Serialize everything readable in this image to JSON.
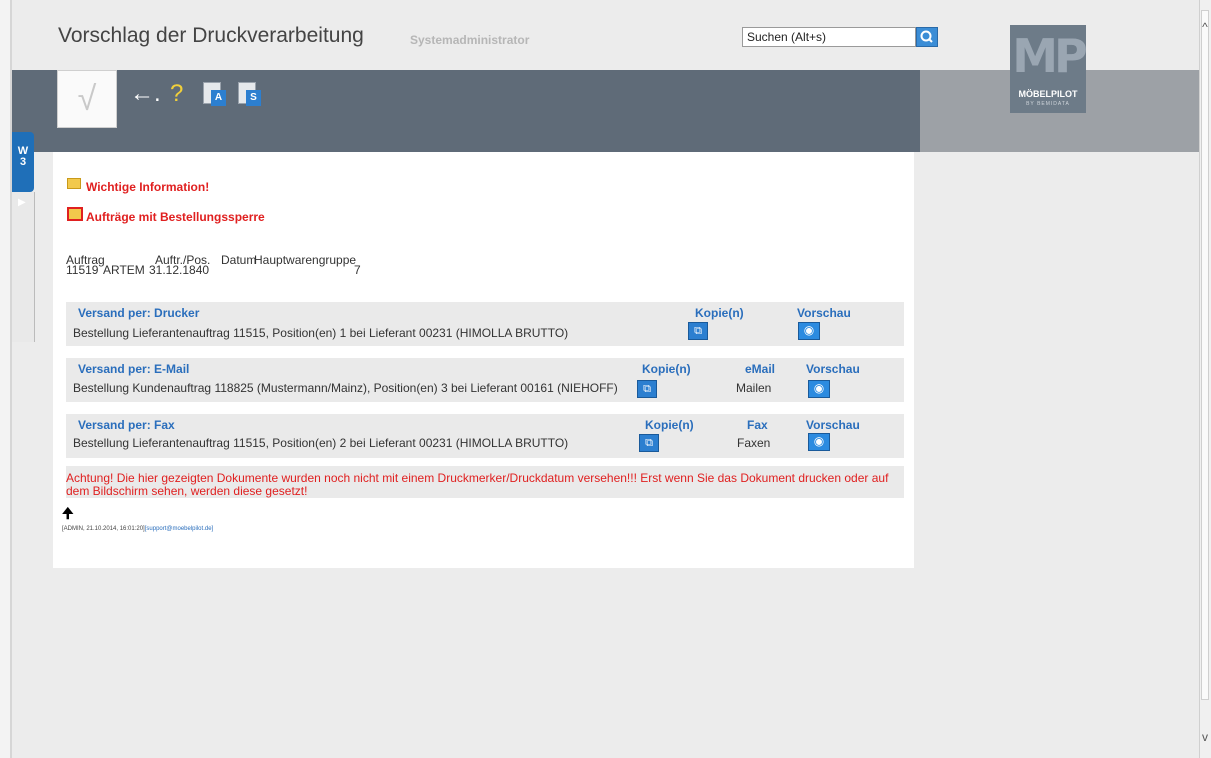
{
  "header": {
    "title": "Vorschlag der Druckverarbeitung",
    "user": "Systemadministrator",
    "search_placeholder": "Suchen (Alt+s)",
    "logo_text": "MP",
    "logo_name": "MÖBELPILOT",
    "logo_sub": "BY BEMIDATA"
  },
  "toolbar": {
    "confirm_symbol": "√",
    "back_symbol": "←.",
    "help_symbol": "?",
    "doc_a_label": "A",
    "doc_s_label": "S"
  },
  "side_tab": {
    "label_line1": "W",
    "label_line2": "3",
    "arrow": "▶"
  },
  "sections": {
    "wichtig": "Wichtige Information!",
    "sperre": "Aufträge mit Bestellungssperre"
  },
  "order_table": {
    "headers": [
      "Auftrag",
      "Auftr./Pos.",
      "Datum",
      "Hauptwarengruppe"
    ],
    "row": [
      "11519",
      "ARTEM",
      "31.12.1840",
      "7"
    ]
  },
  "drucker": {
    "header": "Versand per: Drucker",
    "col_copies": "Kopie(n)",
    "col_preview": "Vorschau",
    "row": "Bestellung Lieferantenauftrag 11515, Position(en) 1 bei Lieferant 00231 (HIMOLLA BRUTTO)"
  },
  "email": {
    "header": "Versand per: E-Mail",
    "col_copies": "Kopie(n)",
    "col_email": "eMail",
    "col_preview": "Vorschau",
    "row": "Bestellung Kundenauftrag 118825 (Mustermann/Mainz), Position(en) 3 bei Lieferant 00161 (NIEHOFF)",
    "action": "Mailen"
  },
  "fax": {
    "header": "Versand per: Fax",
    "col_copies": "Kopie(n)",
    "col_fax": "Fax",
    "col_preview": "Vorschau",
    "row": "Bestellung Lieferantenauftrag 11515, Position(en) 2 bei Lieferant 00231 (HIMOLLA BRUTTO)",
    "action": "Faxen"
  },
  "warning": "Achtung! Die hier gezeigten Dokumente wurden noch nicht mit einem Druckmerker/Druckdatum versehen!!! Erst wenn Sie das Dokument drucken oder auf dem Bildschirm sehen, werden diese gesetzt!",
  "up_arrow": "🠉",
  "footer": {
    "info": "[ADMIN, 21.10.2014, 16:01:20]",
    "email": "[support@moebelpilot.de]"
  },
  "scroll": {
    "up": "^",
    "down": "v"
  },
  "colors": {
    "accent": "#2a6ebc",
    "warning": "#e02020",
    "toolbar": "#5f6b78"
  }
}
